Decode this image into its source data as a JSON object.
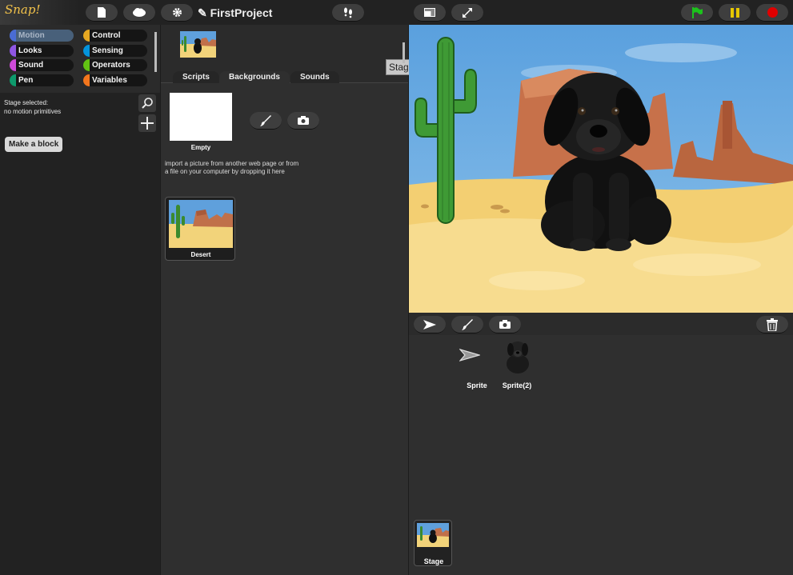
{
  "app": {
    "logo": "Snap!",
    "project_title": "✎ FirstProject"
  },
  "icons": {
    "file": "file-icon",
    "cloud": "cloud-icon",
    "settings": "gear-icon",
    "turbo": "footprints-icon",
    "stage_size": "small-stage-icon",
    "fullscreen": "expand-icon",
    "go": "green-flag-icon",
    "pause": "pause-icon",
    "stop": "stop-icon",
    "search": "magnifier-icon",
    "add": "plus-icon",
    "paint": "paintbrush-icon",
    "camera": "camera-icon",
    "turtle": "arrow-turtle-icon",
    "trash": "trash-icon"
  },
  "colors": {
    "motion": "#4a6cd4",
    "looks": "#8f56e3",
    "sound": "#cf4ad9",
    "pen": "#0e9a6c",
    "control": "#e6a822",
    "sensing": "#0494dc",
    "operators": "#62c213",
    "variables": "#f3761d",
    "go": "#1cc21c",
    "pause": "#e6c800",
    "stop": "#e00000"
  },
  "categories": {
    "left": [
      "Motion",
      "Looks",
      "Sound",
      "Pen"
    ],
    "right": [
      "Control",
      "Sensing",
      "Operators",
      "Variables"
    ]
  },
  "palette": {
    "info_line1": "Stage selected:",
    "info_line2": "no motion primitives",
    "make_block": "Make a block"
  },
  "object": {
    "name": "Stage"
  },
  "tabs": [
    "Scripts",
    "Backgrounds",
    "Sounds"
  ],
  "backgrounds": {
    "empty_label": "Empty",
    "import_hint_line1": "import a picture from another web page or from",
    "import_hint_line2": "a file on your computer by dropping it here",
    "items": [
      "Desert"
    ]
  },
  "corral": {
    "sprites": [
      "Sprite",
      "Sprite(2)"
    ],
    "stage_label": "Stage"
  }
}
